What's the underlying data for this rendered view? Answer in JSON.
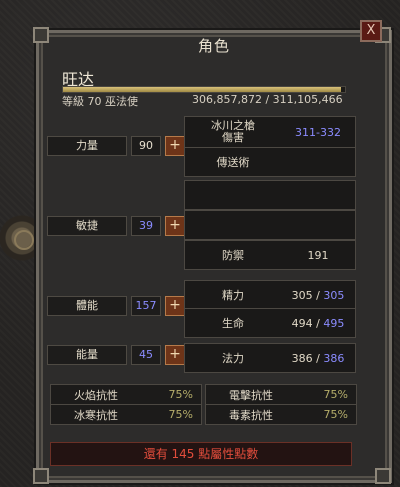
{
  "window": {
    "title": "角色",
    "close": "X"
  },
  "character": {
    "name": "旺达",
    "level_class": "等級 70 巫法使",
    "xp_text": "306,857,872 / 311,105,466",
    "xp_fraction": 0.986
  },
  "attributes": [
    {
      "name": "力量",
      "value": "90",
      "value_color": "#e8e0cf"
    },
    {
      "name": "敏捷",
      "value": "39",
      "value_color": "#8b8cff"
    },
    {
      "name": "體能",
      "value": "157",
      "value_color": "#8b8cff"
    },
    {
      "name": "能量",
      "value": "45",
      "value_color": "#8b8cff"
    }
  ],
  "plus_symbol": "+",
  "skills": [
    {
      "label": "冰川之槍\n傷害",
      "value": "311-332",
      "value_color": "#8b8cff"
    },
    {
      "label": "傳送術",
      "value": ""
    },
    {
      "label": "",
      "value": ""
    },
    {
      "label": "",
      "value": ""
    }
  ],
  "defense": {
    "label": "防禦",
    "value": "191"
  },
  "vitals": {
    "stamina": {
      "label": "精力",
      "cur": "305",
      "max": "305"
    },
    "life": {
      "label": "生命",
      "cur": "494",
      "max": "495"
    },
    "mana": {
      "label": "法力",
      "cur": "386",
      "max": "386"
    }
  },
  "resistances": [
    {
      "name": "火焰抗性",
      "value": "75%"
    },
    {
      "name": "電擊抗性",
      "value": "75%"
    },
    {
      "name": "冰寒抗性",
      "value": "75%"
    },
    {
      "name": "毒素抗性",
      "value": "75%"
    }
  ],
  "footer": {
    "text": "還有 145 點屬性點數"
  },
  "colors": {
    "accent_blue": "#8b8cff",
    "warning_red": "#e24d3c"
  }
}
